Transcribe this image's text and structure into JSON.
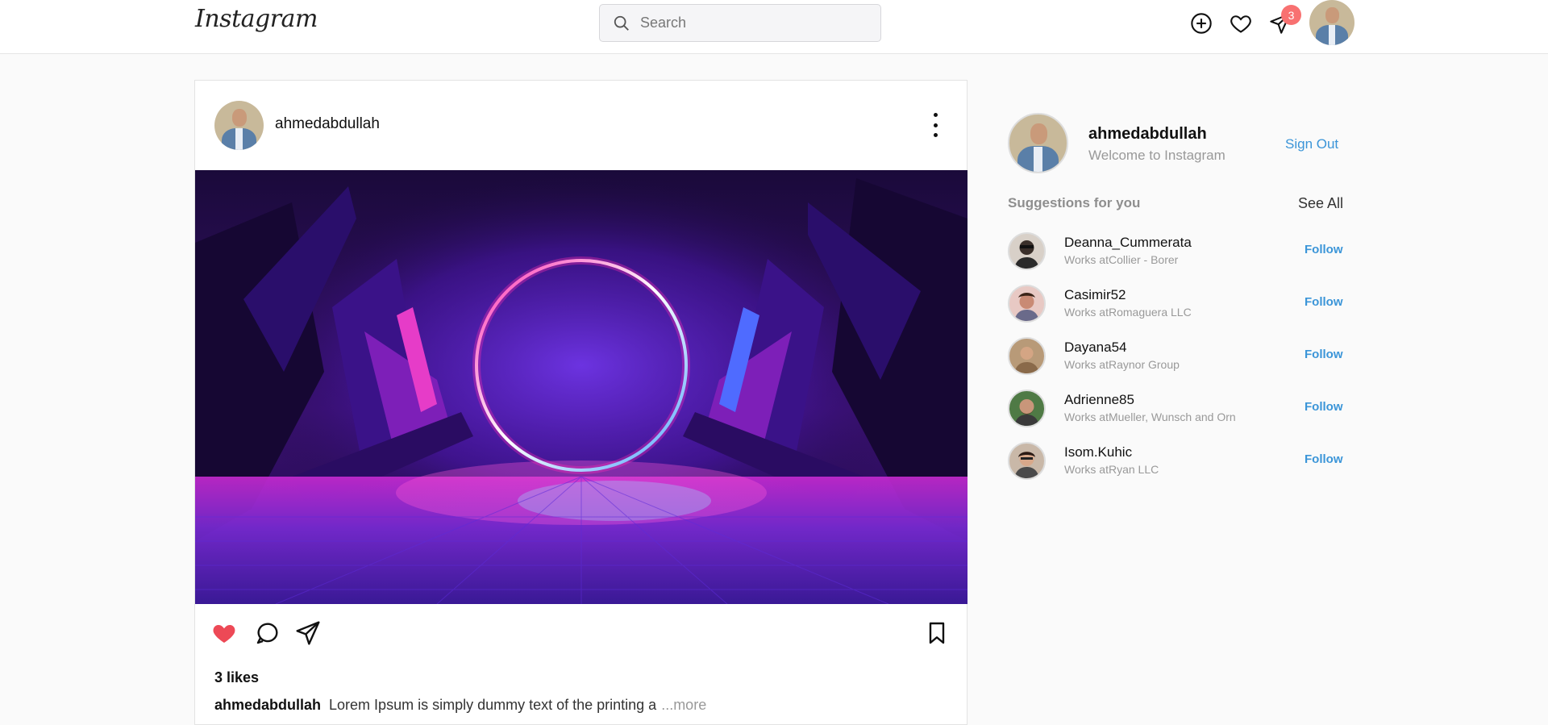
{
  "header": {
    "logo": "Instagram",
    "search_placeholder": "Search",
    "messages_badge": "3",
    "icons": [
      "add-post-icon",
      "heart-icon",
      "paper-plane-icon",
      "profile-avatar"
    ]
  },
  "post": {
    "username": "ahmedabdullah",
    "likes": "3 likes",
    "caption_user": "ahmedabdullah",
    "caption_text": "Lorem Ipsum is simply dummy text of the printing a",
    "caption_more": "...more",
    "liked": true
  },
  "sidebar": {
    "username": "ahmedabdullah",
    "welcome": "Welcome to Instagram",
    "sign_out": "Sign Out",
    "suggestions_title": "Suggestions for you",
    "see_all": "See All",
    "suggestions": [
      {
        "name": "Deanna_Cummerata",
        "work": "Works atCollier - Borer",
        "follow": "Follow"
      },
      {
        "name": "Casimir52",
        "work": "Works atRomaguera LLC",
        "follow": "Follow"
      },
      {
        "name": "Dayana54",
        "work": "Works atRaynor Group",
        "follow": "Follow"
      },
      {
        "name": "Adrienne85",
        "work": "Works atMueller, Wunsch and Orn",
        "follow": "Follow"
      },
      {
        "name": "Isom.Kuhic",
        "work": "Works atRyan LLC",
        "follow": "Follow"
      }
    ]
  },
  "colors": {
    "accent": "#3b95d8",
    "like_red": "#ed4956",
    "badge": "#f87171"
  }
}
